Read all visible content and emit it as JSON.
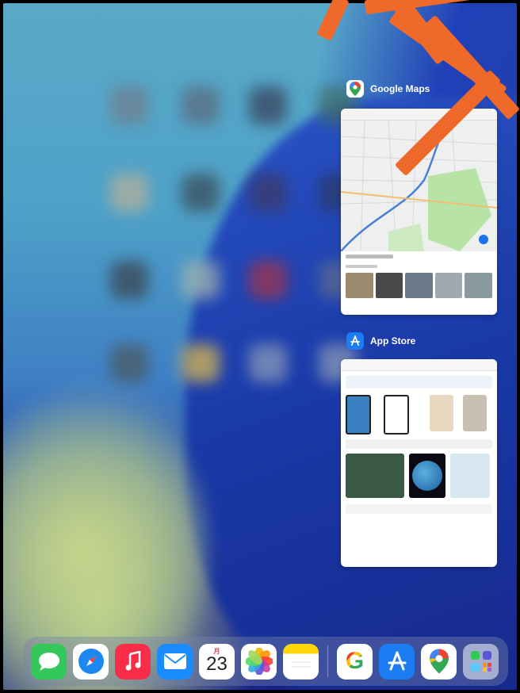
{
  "switcher": {
    "apps": [
      {
        "name": "Google Maps",
        "icon": "google-maps-icon"
      },
      {
        "name": "App Store",
        "icon": "app-store-icon"
      }
    ]
  },
  "dock": {
    "calendar_day_label": "月",
    "calendar_date": "23",
    "google_letter": "G",
    "icons": [
      "messages-icon",
      "safari-icon",
      "music-icon",
      "mail-icon",
      "calendar-icon",
      "photos-icon",
      "notes-icon",
      "google-icon",
      "app-store-icon",
      "google-maps-icon",
      "app-library-icon"
    ]
  },
  "colors": {
    "annotation": "#ef6a2a",
    "maps_park": "#b7e3a6",
    "appstore_blue": "#1d7cf2"
  }
}
